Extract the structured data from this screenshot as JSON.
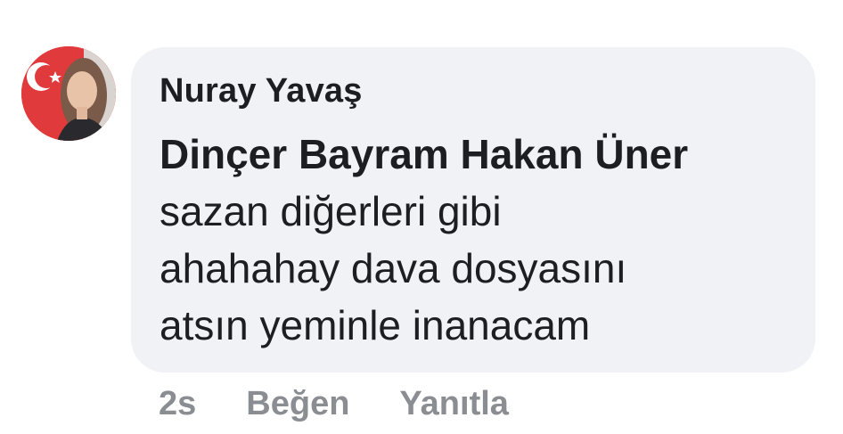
{
  "comment": {
    "author": "Nuray Yavaş",
    "mention": "Dinçer Bayram Hakan Üner",
    "text": "sazan diğerleri gibi ahahahay dava dosyasını atsın yeminle inanacam",
    "text_lines": [
      "sazan diğerleri gibi",
      "ahahahay dava dosyasını",
      "atsın yeminle inanacam"
    ]
  },
  "actions": {
    "timestamp": "2s",
    "like_label": "Beğen",
    "reply_label": "Yanıtla"
  },
  "colors": {
    "bubble_bg": "#f0f2f5",
    "text": "#1c1e21",
    "secondary": "#8a8d91"
  }
}
